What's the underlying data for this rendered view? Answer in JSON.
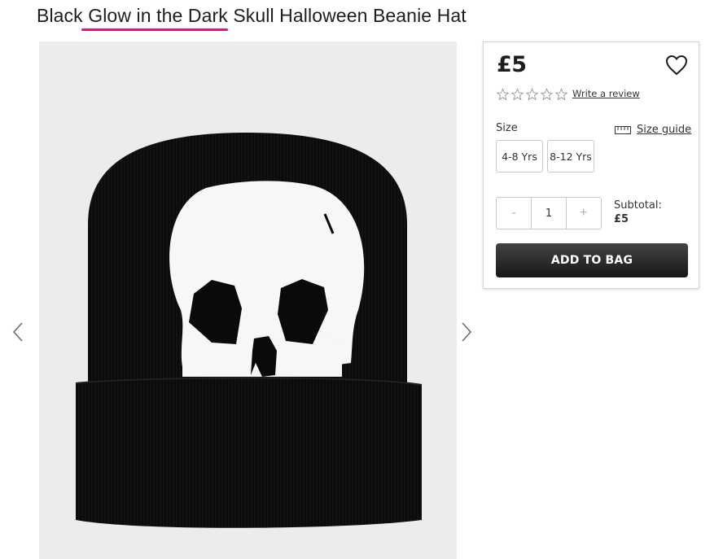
{
  "product": {
    "title_before": "Black ",
    "title_highlight": "Glow in the Dark",
    "title_after": " Skull Halloween Beanie Hat",
    "price": "£5",
    "rating_stars": 0,
    "write_review": "Write a review"
  },
  "size": {
    "label": "Size",
    "guide_label": "Size guide",
    "options": [
      "4-8 Yrs",
      "8-12 Yrs"
    ]
  },
  "quantity": {
    "minus": "-",
    "value": "1",
    "plus": "+"
  },
  "subtotal": {
    "label": "Subtotal:",
    "value": "£5"
  },
  "actions": {
    "add_to_bag": "ADD TO BAG"
  },
  "icons": {
    "wishlist": "heart-icon",
    "star": "star-outline-icon",
    "size_guide": "ruler-icon",
    "prev": "chevron-left-icon",
    "next": "chevron-right-icon"
  },
  "colors": {
    "highlight_underline": "#e8127a",
    "button": "#1d1d1d",
    "image_background": "#ececec"
  }
}
